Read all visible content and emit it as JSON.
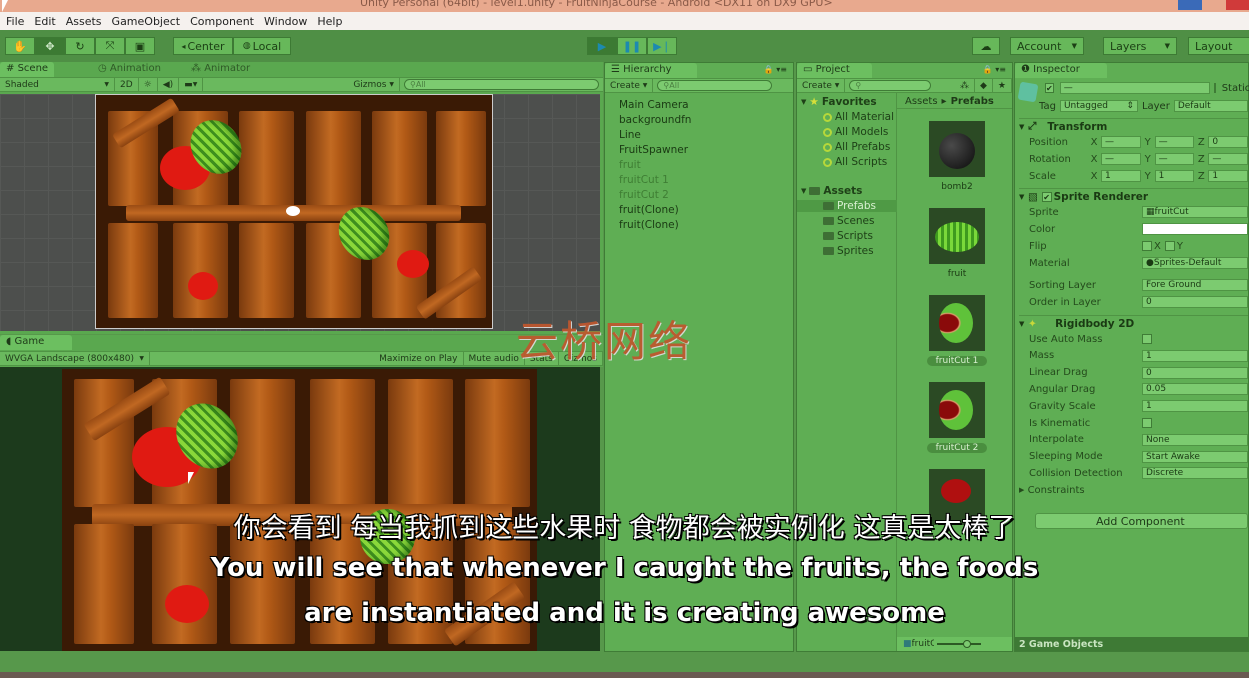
{
  "window": {
    "title": "Unity Personal (64bit) - level1.unity - FruitNinjaCourse - Android <DX11 on DX9 GPU>"
  },
  "menu": [
    "File",
    "Edit",
    "Assets",
    "GameObject",
    "Component",
    "Window",
    "Help"
  ],
  "toolbar": {
    "tools": [
      "hand-tool",
      "move-tool",
      "rotate-tool",
      "scale-tool",
      "rect-tool"
    ],
    "pivot_label": "Center",
    "space_label": "Local",
    "play_label": "Play",
    "pause_label": "Pause",
    "step_label": "Step",
    "account_label": "Account",
    "layers_label": "Layers",
    "layout_label": "Layout"
  },
  "scene": {
    "tabs": [
      "Scene",
      "Animation",
      "Animator"
    ],
    "shading": "Shaded",
    "mode_2d": "2D",
    "gizmos_label": "Gizmos",
    "search_placeholder": "All"
  },
  "game": {
    "tab": "Game",
    "resolution": "WVGA Landscape (800x480)",
    "maximize_label": "Maximize on Play",
    "mute_label": "Mute audio",
    "stats_label": "Stats",
    "gizmos_label": "Gizmos"
  },
  "hierarchy": {
    "tab": "Hierarchy",
    "create_label": "Create",
    "search_placeholder": "All",
    "items": [
      {
        "name": "Main Camera",
        "dim": false
      },
      {
        "name": "backgroundfn",
        "dim": false
      },
      {
        "name": "Line",
        "dim": false
      },
      {
        "name": "FruitSpawner",
        "dim": false
      },
      {
        "name": "fruit",
        "dim": true
      },
      {
        "name": "fruitCut 1",
        "dim": true
      },
      {
        "name": "fruitCut 2",
        "dim": true
      },
      {
        "name": "fruit(Clone)",
        "dim": false
      },
      {
        "name": "fruit(Clone)",
        "dim": false
      }
    ]
  },
  "project": {
    "tab": "Project",
    "create_label": "Create",
    "favorites_label": "Favorites",
    "favorites": [
      "All Material",
      "All Models",
      "All Prefabs",
      "All Scripts"
    ],
    "assets_label": "Assets",
    "folders": [
      "Prefabs",
      "Scenes",
      "Scripts",
      "Sprites"
    ],
    "selected_folder": "Prefabs",
    "breadcrumb": [
      "Assets",
      "Prefabs"
    ],
    "prefabs": [
      "bomb2",
      "fruit",
      "fruitCut 1",
      "fruitCut 2",
      ""
    ],
    "footer_selection": "fruitCut"
  },
  "inspector": {
    "tab": "Inspector",
    "object_name": "—",
    "static_label": "Static",
    "tag_label": "Tag",
    "tag_value": "Untagged",
    "layer_label": "Layer",
    "layer_value": "Default",
    "transform": {
      "title": "Transform",
      "position": {
        "label": "Position",
        "x": "—",
        "y": "—",
        "z": "0"
      },
      "rotation": {
        "label": "Rotation",
        "x": "—",
        "y": "—",
        "z": "—"
      },
      "scale": {
        "label": "Scale",
        "x": "1",
        "y": "1",
        "z": "1"
      }
    },
    "sprite_renderer": {
      "title": "Sprite Renderer",
      "sprite_label": "Sprite",
      "sprite_value": "fruitCut",
      "color_label": "Color",
      "flip_label": "Flip",
      "flip_x": "X",
      "flip_y": "Y",
      "material_label": "Material",
      "material_value": "Sprites-Default",
      "sorting_layer_label": "Sorting Layer",
      "sorting_layer_value": "Fore Ground",
      "order_label": "Order in Layer",
      "order_value": "0"
    },
    "rigidbody2d": {
      "title": "Rigidbody 2D",
      "fields": [
        {
          "label": "Use Auto Mass",
          "type": "check",
          "value": ""
        },
        {
          "label": "Mass",
          "type": "field",
          "value": "1"
        },
        {
          "label": "Linear Drag",
          "type": "field",
          "value": "0"
        },
        {
          "label": "Angular Drag",
          "type": "field",
          "value": "0.05"
        },
        {
          "label": "Gravity Scale",
          "type": "field",
          "value": "1"
        },
        {
          "label": "Is Kinematic",
          "type": "check",
          "value": ""
        },
        {
          "label": "Interpolate",
          "type": "dropdown",
          "value": "None"
        },
        {
          "label": "Sleeping Mode",
          "type": "dropdown",
          "value": "Start Awake"
        },
        {
          "label": "Collision Detection",
          "type": "dropdown",
          "value": "Discrete"
        }
      ],
      "constraints_label": "Constraints"
    },
    "add_component_label": "Add Component",
    "footer": "2 Game Objects"
  },
  "subtitles": {
    "chinese": "你会看到 每当我抓到这些水果时 食物都会被实例化 这真是太棒了",
    "english_line1": "You will see that whenever I caught the fruits, the foods",
    "english_line2": "are instantiated and it is creating awesome"
  },
  "watermark": "云桥网络"
}
